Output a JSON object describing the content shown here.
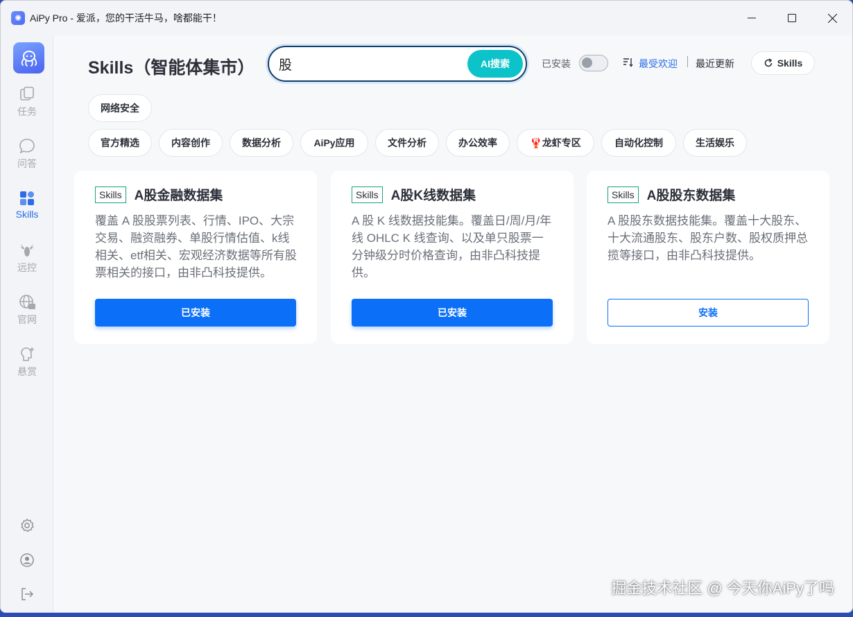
{
  "window": {
    "title": "AiPy Pro - 爱派，您的干活牛马，啥都能干！"
  },
  "sidebar": {
    "items": [
      {
        "label": "任务",
        "icon": "tasks-icon"
      },
      {
        "label": "问答",
        "icon": "chat-icon"
      },
      {
        "label": "Skills",
        "icon": "skills-icon",
        "active": true
      },
      {
        "label": "远控",
        "icon": "lobster-icon"
      },
      {
        "label": "官网",
        "icon": "globe-icon"
      },
      {
        "label": "悬赏",
        "icon": "bounty-icon"
      }
    ],
    "bottom_icons": [
      "settings-icon",
      "user-icon",
      "logout-icon"
    ]
  },
  "header": {
    "title": "Skills（智能体集市）",
    "search_value": "股",
    "ai_search_label": "AI搜索",
    "installed_label": "已安装",
    "installed_toggle_on": false,
    "sort_popular": "最受欢迎",
    "sort_latest": "最近更新",
    "skills_button": "Skills"
  },
  "categories": {
    "row1": [
      "网络安全"
    ],
    "row2": [
      "官方精选",
      "内容创作",
      "数据分析",
      "AiPy应用",
      "文件分析",
      "办公效率",
      "🦞龙虾专区",
      "自动化控制",
      "生活娱乐"
    ]
  },
  "cards": [
    {
      "tag": "Skills",
      "title": "A股金融数据集",
      "desc": "覆盖 A 股股票列表、行情、IPO、大宗交易、融资融券、单股行情估值、k线相关、etf相关、宏观经济数据等所有股票相关的接口，由非凸科技提供。",
      "button": "已安装",
      "installed": true
    },
    {
      "tag": "Skills",
      "title": "A股K线数据集",
      "desc": "A 股 K 线数据技能集。覆盖日/周/月/年线 OHLC K 线查询、以及单只股票一分钟级分时价格查询，由非凸科技提供。",
      "button": "已安装",
      "installed": true
    },
    {
      "tag": "Skills",
      "title": "A股股东数据集",
      "desc": "A 股股东数据技能集。覆盖十大股东、十大流通股东、股东户数、股权质押总揽等接口，由非凸科技提供。",
      "button": "安装",
      "installed": false
    }
  ],
  "watermark": "掘金技术社区 @ 今天你AiPy了吗",
  "colors": {
    "accent": "#0b6ff7",
    "ai_button": "#0cc3c9",
    "active_nav": "#2a6de7",
    "tag_border": "#1aa07a"
  }
}
